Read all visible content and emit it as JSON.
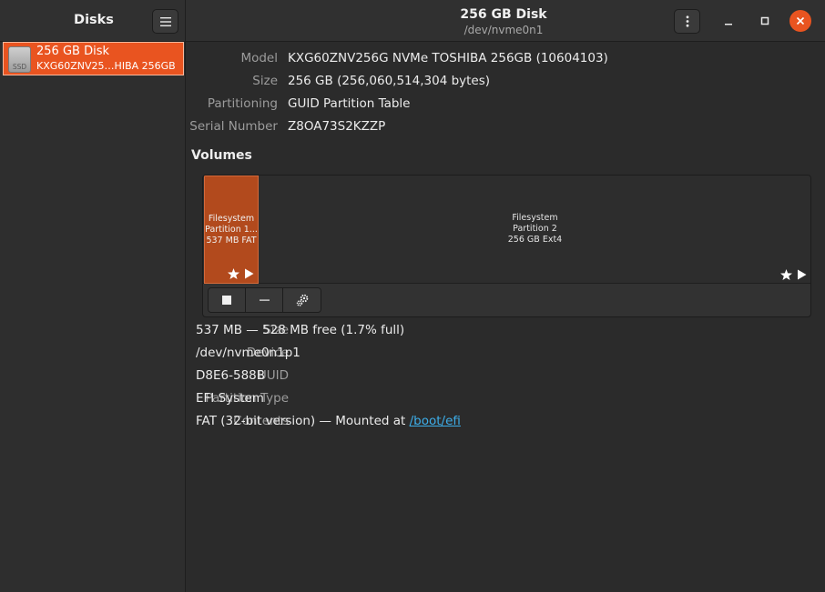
{
  "sidebar": {
    "title": "Disks",
    "disks": [
      {
        "icon_label": "SSD",
        "name": "256 GB Disk",
        "subtitle": "KXG60ZNV25…HIBA 256GB"
      }
    ]
  },
  "header": {
    "title": "256 GB Disk",
    "subtitle": "/dev/nvme0n1"
  },
  "drive": {
    "fields": [
      {
        "key": "Model",
        "value": "KXG60ZNV256G NVMe TOSHIBA 256GB (10604103)"
      },
      {
        "key": "Size",
        "value": "256 GB (256,060,514,304 bytes)"
      },
      {
        "key": "Partitioning",
        "value": "GUID Partition Table"
      },
      {
        "key": "Serial Number",
        "value": "Z8OA73S2KZZP"
      }
    ]
  },
  "volumes": {
    "title": "Volumes",
    "partitions": [
      {
        "line1": "Filesystem",
        "line2": "Partition 1...",
        "line3": "537 MB FAT",
        "selected": true
      },
      {
        "line1": "Filesystem",
        "line2": "Partition 2",
        "line3": "256 GB Ext4",
        "selected": false
      }
    ]
  },
  "partition_details": {
    "fields": [
      {
        "key": "Size",
        "value": "537 MB — 528 MB free (1.7% full)"
      },
      {
        "key": "Device",
        "value": "/dev/nvme0n1p1"
      },
      {
        "key": "UUID",
        "value": "D8E6-588B"
      },
      {
        "key": "Partition Type",
        "value": "EFI System"
      },
      {
        "key": "Contents",
        "value": "FAT (32-bit version) — Mounted at ",
        "link": "/boot/efi"
      }
    ]
  },
  "colors": {
    "accent": "#e95420",
    "partition_selected": "#b24a1d",
    "link": "#3daee9"
  }
}
